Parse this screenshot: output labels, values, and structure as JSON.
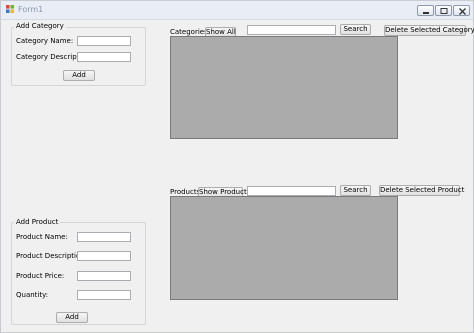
{
  "window": {
    "title": "Form1"
  },
  "add_category": {
    "group_title": "Add Category",
    "name_label": "Category Name:",
    "name_value": "",
    "description_label": "Category Description:",
    "description_value": "",
    "add_label": "Add"
  },
  "categories": {
    "label": "Categories",
    "show_all_label": "Show All",
    "search_value": "",
    "search_label": "Search",
    "delete_label": "Delete Selected Category"
  },
  "products": {
    "label": "Products",
    "show_label": "Show Products",
    "search_value": "",
    "search_label": "Search",
    "delete_label": "Delete Selected Product"
  },
  "add_product": {
    "group_title": "Add Product",
    "name_label": "Product Name:",
    "name_value": "",
    "description_label": "Product Description:",
    "description_value": "",
    "price_label": "Product Price:",
    "price_value": "",
    "quantity_label": "Quantity:",
    "quantity_value": "",
    "add_label": "Add"
  },
  "colors": {
    "grid_bg": "#ababab",
    "window_bg": "#f0f0f0"
  }
}
